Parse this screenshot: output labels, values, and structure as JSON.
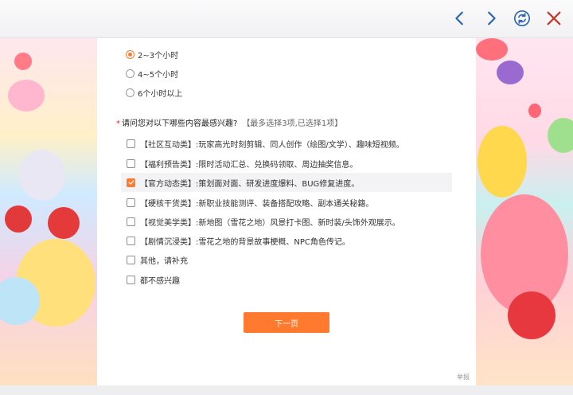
{
  "toolbar": {
    "back_icon": "chevron-left-icon",
    "forward_icon": "chevron-right-icon",
    "refresh_icon": "refresh-icon",
    "close_icon": "close-icon",
    "icon_color": "#2f68b0"
  },
  "time_question": {
    "options": [
      {
        "label": "2~3个小时",
        "checked": true
      },
      {
        "label": "4~5个小时",
        "checked": false
      },
      {
        "label": "6个小时以上",
        "checked": false
      }
    ]
  },
  "interest_question": {
    "required_mark": "*",
    "title": "请问您对以下哪些内容最感兴趣?",
    "hint": "【最多选择3项,已选择1项】",
    "options": [
      {
        "label": "【社区互动类】:玩家高光时刻剪辑、同人创作（绘图/文学）、趣味短视频。",
        "checked": false
      },
      {
        "label": "【福利预告类】:限时活动汇总、兑换码领取、周边抽奖信息。",
        "checked": false
      },
      {
        "label": "【官方动态类】:策划面对面、研发进度爆料、BUG修复进度。",
        "checked": true
      },
      {
        "label": "【硬核干货类】:新职业技能测评、装备搭配攻略、副本通关秘籍。",
        "checked": false
      },
      {
        "label": "【视觉美学类】:新地图（雪花之地）风景打卡图、新时装/头饰外观展示。",
        "checked": false
      },
      {
        "label": "【剧情沉浸类】:雪花之地的背景故事梗概、NPC角色传记。",
        "checked": false
      },
      {
        "label": "其他，请补充",
        "checked": false
      },
      {
        "label": "都不感兴趣",
        "checked": false
      }
    ]
  },
  "actions": {
    "next_label": "下一页",
    "report_label": "举报"
  },
  "colors": {
    "accent": "#ff7a2f",
    "required": "#e02b2b"
  }
}
